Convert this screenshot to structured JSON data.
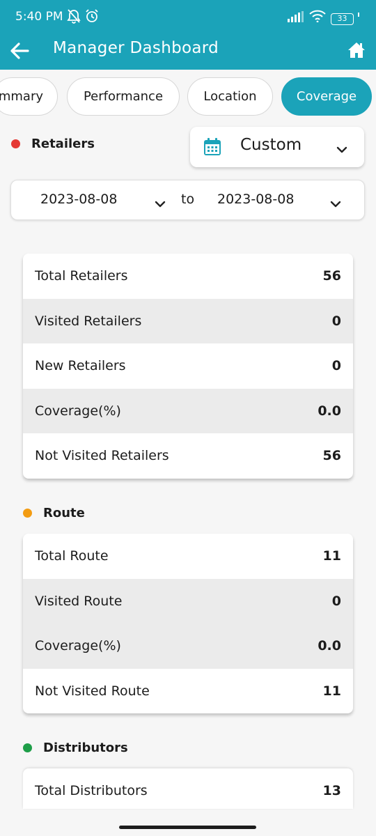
{
  "status": {
    "time": "5:40 PM",
    "battery": "33"
  },
  "appbar": {
    "title": "Manager Dashboard"
  },
  "tabs": [
    {
      "label": "mmary",
      "active": false
    },
    {
      "label": "Performance",
      "active": false
    },
    {
      "label": "Location",
      "active": false
    },
    {
      "label": "Coverage",
      "active": true
    }
  ],
  "filter": {
    "period": "Custom",
    "from": "2023-08-08",
    "to_label": "to",
    "to": "2023-08-08"
  },
  "sections": {
    "retailers": {
      "title": "Retailers",
      "color": "#e53935",
      "rows": [
        {
          "label": "Total Retailers",
          "value": "56"
        },
        {
          "label": "Visited Retailers",
          "value": "0"
        },
        {
          "label": "New Retailers",
          "value": "0"
        },
        {
          "label": "Coverage(%)",
          "value": "0.0"
        },
        {
          "label": "Not Visited Retailers",
          "value": "56"
        }
      ]
    },
    "route": {
      "title": "Route",
      "color": "#f39c12",
      "rows": [
        {
          "label": "Total Route",
          "value": "11"
        },
        {
          "label": "Visited Route",
          "value": "0"
        },
        {
          "label": "Coverage(%)",
          "value": "0.0"
        },
        {
          "label": "Not Visited Route",
          "value": "11"
        }
      ]
    },
    "distributors": {
      "title": "Distributors",
      "color": "#1e9e48",
      "rows": [
        {
          "label": "Total Distributors",
          "value": "13"
        }
      ]
    }
  }
}
